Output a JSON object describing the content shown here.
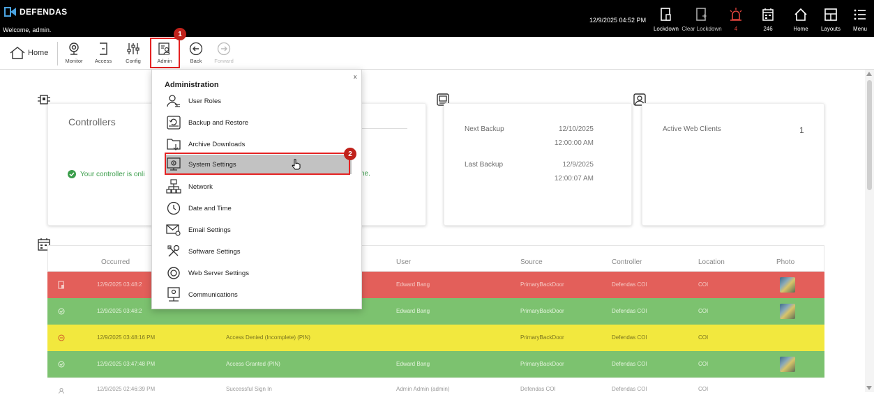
{
  "app": {
    "brand": "DEFENDAS",
    "welcome": "Welcome, admin."
  },
  "topbar": {
    "clock": "12/9/2025 04:52 PM",
    "buttons": [
      {
        "label": "Lockdown",
        "icon": "lockdown-icon"
      },
      {
        "label": "Clear Lockdown",
        "icon": "clear-lockdown-icon"
      },
      {
        "label": "4",
        "icon": "alarm-icon",
        "color": "#e0433c"
      },
      {
        "label": "246",
        "icon": "events-icon"
      },
      {
        "label": "Home",
        "icon": "home-icon"
      },
      {
        "label": "Layouts",
        "icon": "layouts-icon"
      },
      {
        "label": "Menu",
        "icon": "menu-icon"
      }
    ]
  },
  "toolbar": {
    "home": "Home",
    "items": [
      "Monitor",
      "Access",
      "Config",
      "Admin",
      "Back",
      "Forward"
    ]
  },
  "annotations": {
    "step1": "1",
    "step2": "2"
  },
  "controllers_card": {
    "title": "Controllers",
    "message": "Your controller is onli",
    "message_tail": "ne."
  },
  "backup_card": {
    "next_label": "Next Backup",
    "next_date": "12/10/2025",
    "next_time": "12:00:00 AM",
    "last_label": "Last Backup",
    "last_date": "12/9/2025",
    "last_time": "12:00:07 AM"
  },
  "clients_card": {
    "label": "Active Web Clients",
    "value": "1"
  },
  "events": {
    "headers": [
      "Occurred",
      "User",
      "Source",
      "Controller",
      "Location",
      "Photo"
    ],
    "rows": [
      {
        "occurred": "12/9/2025 03:48:2",
        "event": "",
        "user": "Edward Bang",
        "source": "PrimaryBackDoor",
        "controller": "Defendas COI",
        "location": "COI"
      },
      {
        "occurred": "12/9/2025 03:48:2",
        "event": "",
        "user": "Edward Bang",
        "source": "PrimaryBackDoor",
        "controller": "Defendas COI",
        "location": "COI"
      },
      {
        "occurred": "12/9/2025 03:48:16 PM",
        "event": "Access Denied (Incomplete) (PIN)",
        "user": "",
        "source": "PrimaryBackDoor",
        "controller": "Defendas COI",
        "location": "COI"
      },
      {
        "occurred": "12/9/2025 03:47:48 PM",
        "event": "Access Granted (PIN)",
        "user": "Edward Bang",
        "source": "PrimaryBackDoor",
        "controller": "Defendas COI",
        "location": "COI"
      },
      {
        "occurred": "12/9/2025 02:46:39 PM",
        "event": "Successful Sign In",
        "user": "Admin Admin (admin)",
        "source": "Defendas COI",
        "controller": "Defendas COI",
        "location": "COI"
      }
    ]
  },
  "admin_menu": {
    "close": "x",
    "title": "Administration",
    "items": [
      "User Roles",
      "Backup and Restore",
      "Archive Downloads",
      "System Settings",
      "Network",
      "Date and Time",
      "Email Settings",
      "Software Settings",
      "Web Server Settings",
      "Communications"
    ]
  }
}
